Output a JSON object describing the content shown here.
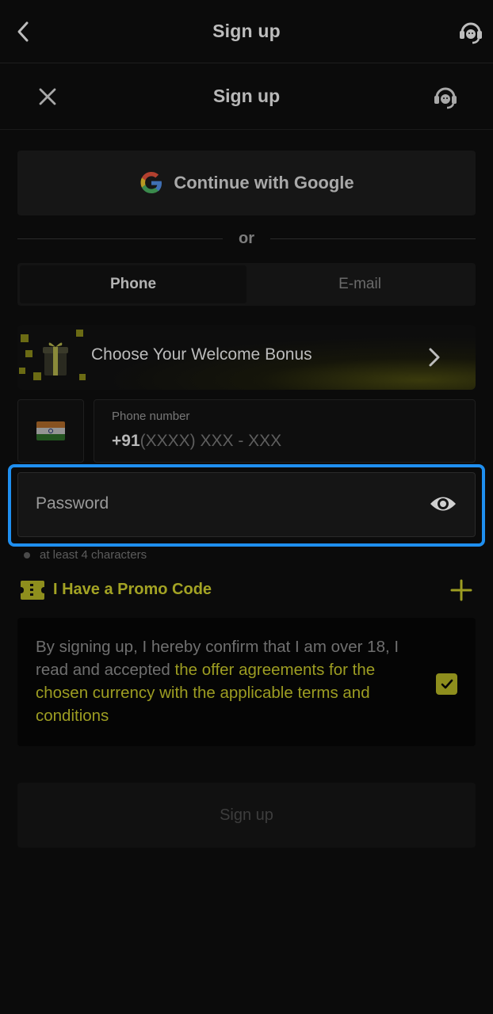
{
  "appbar": {
    "title": "Sign up"
  },
  "modal": {
    "title": "Sign up",
    "google_label": "Continue with Google",
    "divider_text": "or",
    "tabs": [
      {
        "label": "Phone",
        "active": true
      },
      {
        "label": "E-mail",
        "active": false
      }
    ],
    "bonus_label": "Choose Your Welcome Bonus",
    "phone": {
      "label": "Phone number",
      "country_code": "+91",
      "placeholder": "(XXXX) XXX - XXX"
    },
    "password": {
      "placeholder": "Password",
      "hint": "at least 4 characters"
    },
    "promo_label": "I Have a Promo Code",
    "agreement": {
      "prefix": "By signing up, I hereby confirm that I am over 18, I read and accepted ",
      "link": "the offer agreements for the chosen currency with the applicable terms and conditions",
      "checked": true
    },
    "submit_label": "Sign up"
  },
  "colors": {
    "accent": "#9d9d22",
    "focus": "#1f8ff0",
    "background": "#0b0b0b"
  },
  "icons": [
    "back-arrow-icon",
    "support-headset-icon",
    "close-icon",
    "google-logo-icon",
    "gift-icon",
    "chevron-right-icon",
    "india-flag-icon",
    "eye-icon",
    "ticket-icon",
    "plus-icon",
    "checkmark-icon"
  ]
}
